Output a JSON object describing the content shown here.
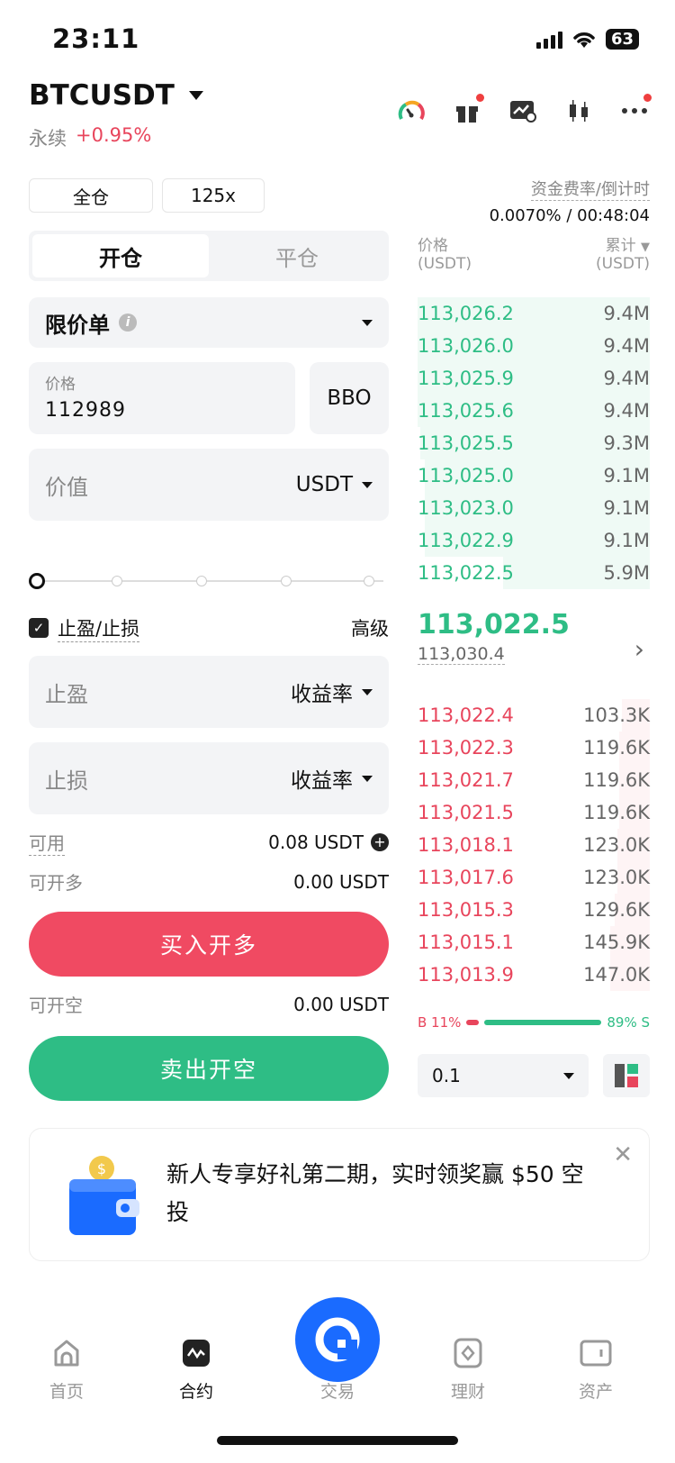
{
  "status": {
    "time": "23:11",
    "battery": "63"
  },
  "header": {
    "symbol": "BTCUSDT",
    "contract_type": "永续",
    "change": "+0.95%",
    "icons": [
      "gauge-icon",
      "gift-icon",
      "chart-edit-icon",
      "candlestick-icon",
      "more-icon"
    ]
  },
  "margin": {
    "mode": "全仓",
    "leverage": "125x"
  },
  "funding": {
    "label": "资金费率/倒计时",
    "value": "0.0070% / 00:48:04"
  },
  "tabs": {
    "open": "开仓",
    "close": "平仓"
  },
  "order": {
    "type": "限价单",
    "price_label": "价格",
    "price_value": "112989",
    "bbo": "BBO",
    "value_label": "价值",
    "value_unit": "USDT",
    "slider_percent": 0
  },
  "tpsl": {
    "label": "止盈/止损",
    "checked": true,
    "advanced": "高级",
    "tp_label": "止盈",
    "tp_mode": "收益率",
    "sl_label": "止损",
    "sl_mode": "收益率"
  },
  "account": {
    "available_label": "可用",
    "available_value": "0.08 USDT",
    "can_long_label": "可开多",
    "can_long_value": "0.00 USDT",
    "can_short_label": "可开空",
    "can_short_value": "0.00 USDT"
  },
  "buttons": {
    "buy": "买入开多",
    "sell": "卖出开空"
  },
  "orderbook": {
    "price_header": "价格",
    "price_unit": "(USDT)",
    "qty_header": "累计",
    "qty_unit": "(USDT)",
    "asks": [
      {
        "price": "113,026.2",
        "qty": "9.4M"
      },
      {
        "price": "113,026.0",
        "qty": "9.4M"
      },
      {
        "price": "113,025.9",
        "qty": "9.4M"
      },
      {
        "price": "113,025.6",
        "qty": "9.4M"
      },
      {
        "price": "113,025.5",
        "qty": "9.3M"
      },
      {
        "price": "113,025.0",
        "qty": "9.1M"
      },
      {
        "price": "113,023.0",
        "qty": "9.1M"
      },
      {
        "price": "113,022.9",
        "qty": "9.1M"
      },
      {
        "price": "113,022.5",
        "qty": "5.9M"
      }
    ],
    "last_price": "113,022.5",
    "mark_price": "113,030.4",
    "bids": [
      {
        "price": "113,022.4",
        "qty": "103.3K"
      },
      {
        "price": "113,022.3",
        "qty": "119.6K"
      },
      {
        "price": "113,021.7",
        "qty": "119.6K"
      },
      {
        "price": "113,021.5",
        "qty": "119.6K"
      },
      {
        "price": "113,018.1",
        "qty": "123.0K"
      },
      {
        "price": "113,017.6",
        "qty": "123.0K"
      },
      {
        "price": "113,015.3",
        "qty": "129.6K"
      },
      {
        "price": "113,015.1",
        "qty": "145.9K"
      },
      {
        "price": "113,013.9",
        "qty": "147.0K"
      }
    ],
    "buy_ratio": "B 11%",
    "sell_ratio": "89% S",
    "depth": "0.1"
  },
  "promo": {
    "text": "新人专享好礼第二期，实时领奖赢 $50 空投"
  },
  "nav": {
    "home": "首页",
    "futures": "合约",
    "trade": "交易",
    "earn": "理财",
    "assets": "资产"
  },
  "colors": {
    "up": "#2ebd85",
    "down": "#e8455c",
    "accent": "#1a6bff"
  }
}
